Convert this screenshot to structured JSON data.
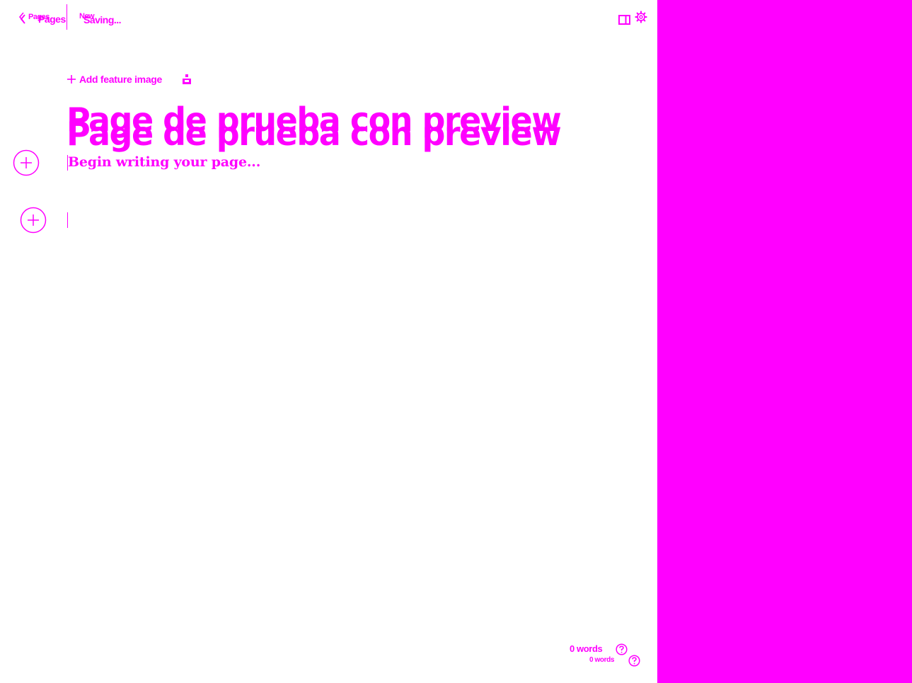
{
  "header": {
    "back_label": "Pages",
    "status_label": "New",
    "saving_label": "Saving..."
  },
  "editor": {
    "add_feature_image_label": "Add feature image",
    "title": "Page de prueba con preview",
    "body_placeholder": "Begin writing your page..."
  },
  "footer": {
    "word_count": "0 words"
  },
  "icons": {
    "back": "chevron-left-icon",
    "sidebar_toggle": "sidebar-panel-icon",
    "settings": "gear-icon",
    "add_image": "plus-icon",
    "upload": "upload-icon",
    "add_card": "plus-circle-icon",
    "help": "question-circle-icon"
  },
  "colors": {
    "accent": "#ff00ff",
    "background": "#ffffff"
  }
}
